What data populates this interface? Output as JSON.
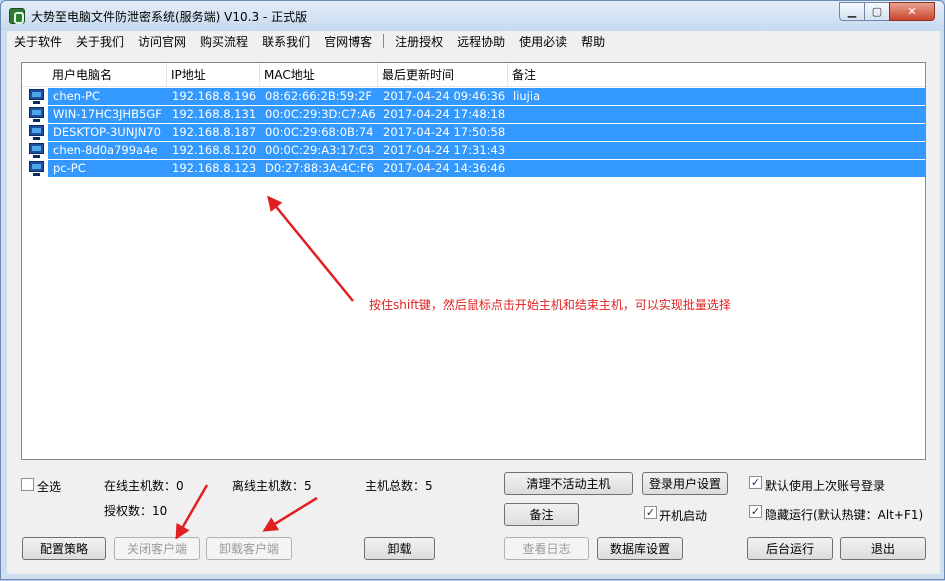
{
  "window": {
    "title": "大势至电脑文件防泄密系统(服务端) V10.3 - 正式版",
    "buttons": {
      "minimize": "▁",
      "maximize": "▢",
      "close": "✕"
    }
  },
  "menu": {
    "items": [
      "关于软件",
      "关于我们",
      "访问官网",
      "购买流程",
      "联系我们",
      "官网博客",
      "注册授权",
      "远程协助",
      "使用必读",
      "帮助"
    ],
    "separator_after": "官网博客"
  },
  "list": {
    "columns": [
      "用户电脑名",
      "IP地址",
      "MAC地址",
      "最后更新时间",
      "备注"
    ],
    "rows": [
      {
        "name": "chen-PC",
        "ip": "192.168.8.196",
        "mac": "08:62:66:2B:59:2F",
        "time": "2017-04-24 09:46:36",
        "note": "liujia"
      },
      {
        "name": "WIN-17HC3JHB5GF",
        "ip": "192.168.8.131",
        "mac": "00:0C:29:3D:C7:A6",
        "time": "2017-04-24 17:48:18",
        "note": ""
      },
      {
        "name": "DESKTOP-3UNJN70",
        "ip": "192.168.8.187",
        "mac": "00:0C:29:68:0B:74",
        "time": "2017-04-24 17:50:58",
        "note": ""
      },
      {
        "name": "chen-8d0a799a4e",
        "ip": "192.168.8.120",
        "mac": "00:0C:29:A3:17:C3",
        "time": "2017-04-24 17:31:43",
        "note": ""
      },
      {
        "name": "pc-PC",
        "ip": "192.168.8.123",
        "mac": "D0:27:88:3A:4C:F6",
        "time": "2017-04-24 14:36:46",
        "note": ""
      }
    ],
    "selection_color": "#3399ff"
  },
  "annotation": "按住shift键，然后鼠标点击开始主机和结束主机，可以实现批量选择",
  "annotation_color": "#e02020",
  "stats": {
    "select_all": "全选",
    "online_label": "在线主机数：0",
    "offline_label": "离线主机数：5",
    "total_label": "主机总数：5",
    "license_label": "授权数：10"
  },
  "buttons": {
    "clean_inactive": "清理不活动主机",
    "login_settings": "登录用户设置",
    "note": "备注",
    "config_policy": "配置策略",
    "close_client": "关闭客户端",
    "uninstall_client": "卸载客户端",
    "uninstall": "卸载",
    "view_log": "查看日志",
    "db_settings": "数据库设置",
    "background_run": "后台运行",
    "exit": "退出"
  },
  "options": {
    "use_last_account": {
      "label": "默认使用上次账号登录",
      "checked": true
    },
    "autostart": {
      "label": "开机启动",
      "checked": true
    },
    "hidden_run": {
      "label": "隐藏运行(默认热键：Alt+F1)",
      "checked": true
    }
  }
}
